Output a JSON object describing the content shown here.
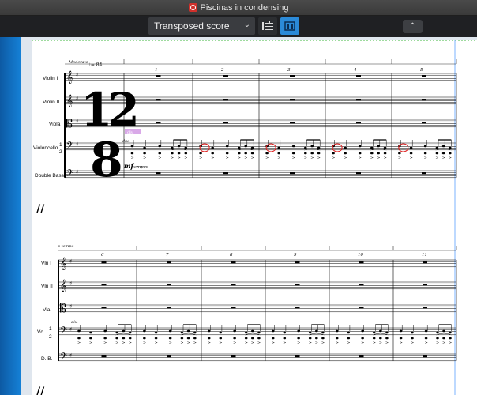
{
  "window": {
    "title": "Piscinas in condensing",
    "app_icon": "app-icon"
  },
  "toolbar": {
    "view_select": {
      "value": "Transposed score",
      "icon": "chevron-down-icon"
    },
    "galley_view_icon": "galley-view-icon",
    "page_view_icon": "page-view-icon",
    "collapse_icon": "chevron-up-icon",
    "accent_color": "#2b8ad8"
  },
  "score": {
    "system1": {
      "tempo_text": "Moderato",
      "tempo_mark": "♩= 84",
      "instruments": [
        "Violin I",
        "Violin II",
        "Viola",
        "Violoncello",
        "Double Bass"
      ],
      "divisi_numbers": [
        "1",
        "2"
      ],
      "bar_numbers": [
        "1",
        "2",
        "3",
        "4",
        "5"
      ],
      "time_signature": {
        "top": "12",
        "bottom": "8"
      },
      "div_text": "div.",
      "dynamic": "mf",
      "dynamic_text": "sempre",
      "condensed_tag": "div.",
      "condensed_tag_color": "#d9a9e8"
    },
    "system2": {
      "tempo_text": "a tempo",
      "instruments": [
        "Vln I",
        "Vln II",
        "Vla",
        "Vc.",
        "D. B."
      ],
      "divisi_numbers": [
        "1",
        "2"
      ],
      "bar_numbers": [
        "6",
        "7",
        "8",
        "9",
        "10",
        "11"
      ],
      "div_text": "div."
    },
    "highlight_color": "#e02020"
  }
}
